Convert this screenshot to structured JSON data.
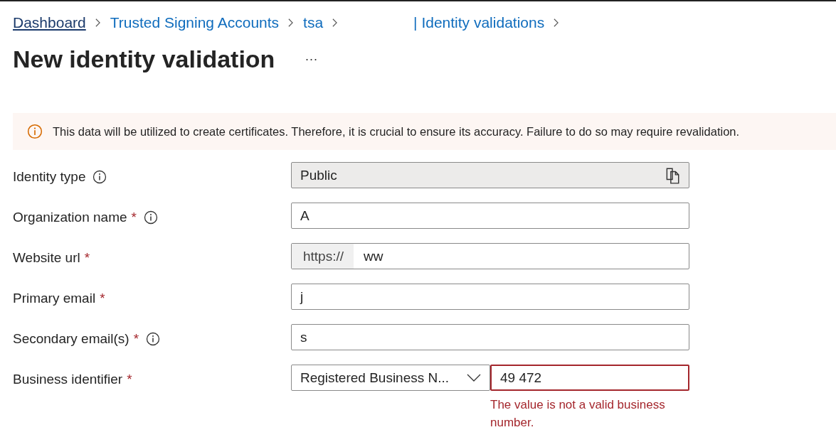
{
  "breadcrumb": [
    {
      "label": "Dashboard",
      "underlined": true
    },
    {
      "label": "Trusted Signing Accounts",
      "underlined": false
    },
    {
      "label": "tsa",
      "underlined": false
    },
    {
      "label": "| Identity validations",
      "underlined": false
    }
  ],
  "title": "New identity validation",
  "more": "···",
  "banner": {
    "text": "This data will be utilized to create certificates. Therefore, it is crucial to ensure its accuracy. Failure to do so may require revalidation."
  },
  "fields": [
    {
      "kind": "readonly",
      "label": "Identity type",
      "info": true,
      "value": "Public"
    },
    {
      "kind": "text",
      "label": "Organization name",
      "required_mark": "*",
      "info": true,
      "value": "A"
    },
    {
      "kind": "url",
      "label": "Website url",
      "required_mark": "*",
      "info": false,
      "prefix": "https://",
      "value": "ww"
    },
    {
      "kind": "text",
      "label": "Primary email",
      "required_mark": "*",
      "info": false,
      "value": "j"
    },
    {
      "kind": "text",
      "label": "Secondary email(s)",
      "required_mark": "*",
      "info": true,
      "value": "s"
    },
    {
      "kind": "split",
      "label": "Business identifier",
      "required_mark": "*",
      "info": false,
      "select": "Registered Business N...",
      "value": "49 472",
      "error": "The value is not a valid business number."
    }
  ]
}
